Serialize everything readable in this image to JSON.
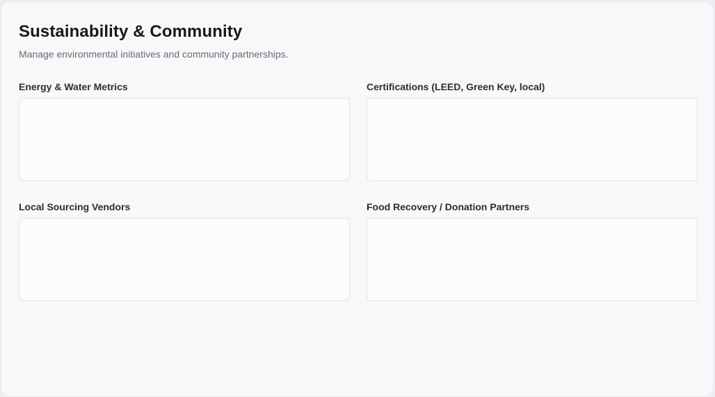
{
  "section": {
    "title": "Sustainability & Community",
    "subtitle": "Manage environmental initiatives and community partnerships."
  },
  "fields": {
    "energy_water": {
      "label": "Energy & Water Metrics",
      "value": ""
    },
    "certifications": {
      "label": "Certifications (LEED, Green Key, local)",
      "value": ""
    },
    "local_sourcing": {
      "label": "Local Sourcing Vendors",
      "value": ""
    },
    "food_recovery": {
      "label": "Food Recovery / Donation Partners",
      "value": ""
    }
  },
  "colors": {
    "background": "#f8f8fa",
    "title": "#17181b",
    "subtitle": "#686b73",
    "field_border": "#e1e3e7"
  }
}
